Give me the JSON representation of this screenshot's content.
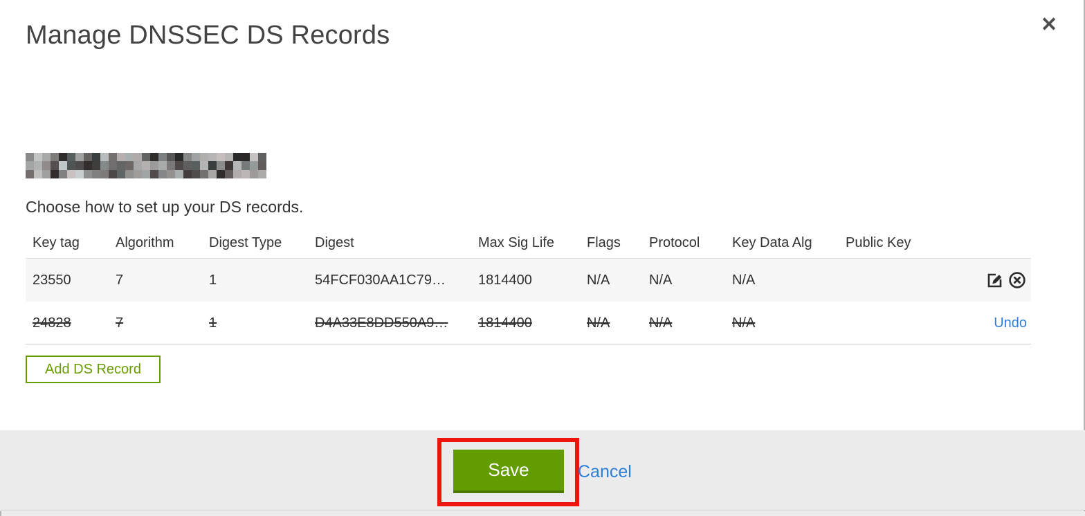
{
  "modal": {
    "title": "Manage DNSSEC DS Records",
    "close_icon": "✕",
    "instruction": "Choose how to set up your DS records.",
    "table": {
      "headers": [
        "Key tag",
        "Algorithm",
        "Digest Type",
        "Digest",
        "Max Sig Life",
        "Flags",
        "Protocol",
        "Key Data Alg",
        "Public Key"
      ],
      "rows": [
        {
          "key_tag": "23550",
          "algorithm": "7",
          "digest_type": "1",
          "digest": "54FCF030AA1C79…",
          "max_sig_life": "1814400",
          "flags": "N/A",
          "protocol": "N/A",
          "key_data_alg": "N/A",
          "public_key": "",
          "status": "active"
        },
        {
          "key_tag": "24828",
          "algorithm": "7",
          "digest_type": "1",
          "digest": "D4A33E8DD550A9…",
          "max_sig_life": "1814400",
          "flags": "N/A",
          "protocol": "N/A",
          "key_data_alg": "N/A",
          "public_key": "",
          "status": "marked-for-deletion",
          "undo_label": "Undo"
        }
      ]
    },
    "add_ds_record_label": "Add DS Record",
    "footer": {
      "save_label": "Save",
      "cancel_label": "Cancel"
    }
  },
  "colors": {
    "accent_green": "#689d00",
    "button_green": "#629c00",
    "button_green_dark": "#4e7a00",
    "link_blue": "#2d7ed9",
    "annotation_red": "#ee150d",
    "row_alt_bg": "#f7f7f7",
    "footer_bg": "#ececec"
  }
}
